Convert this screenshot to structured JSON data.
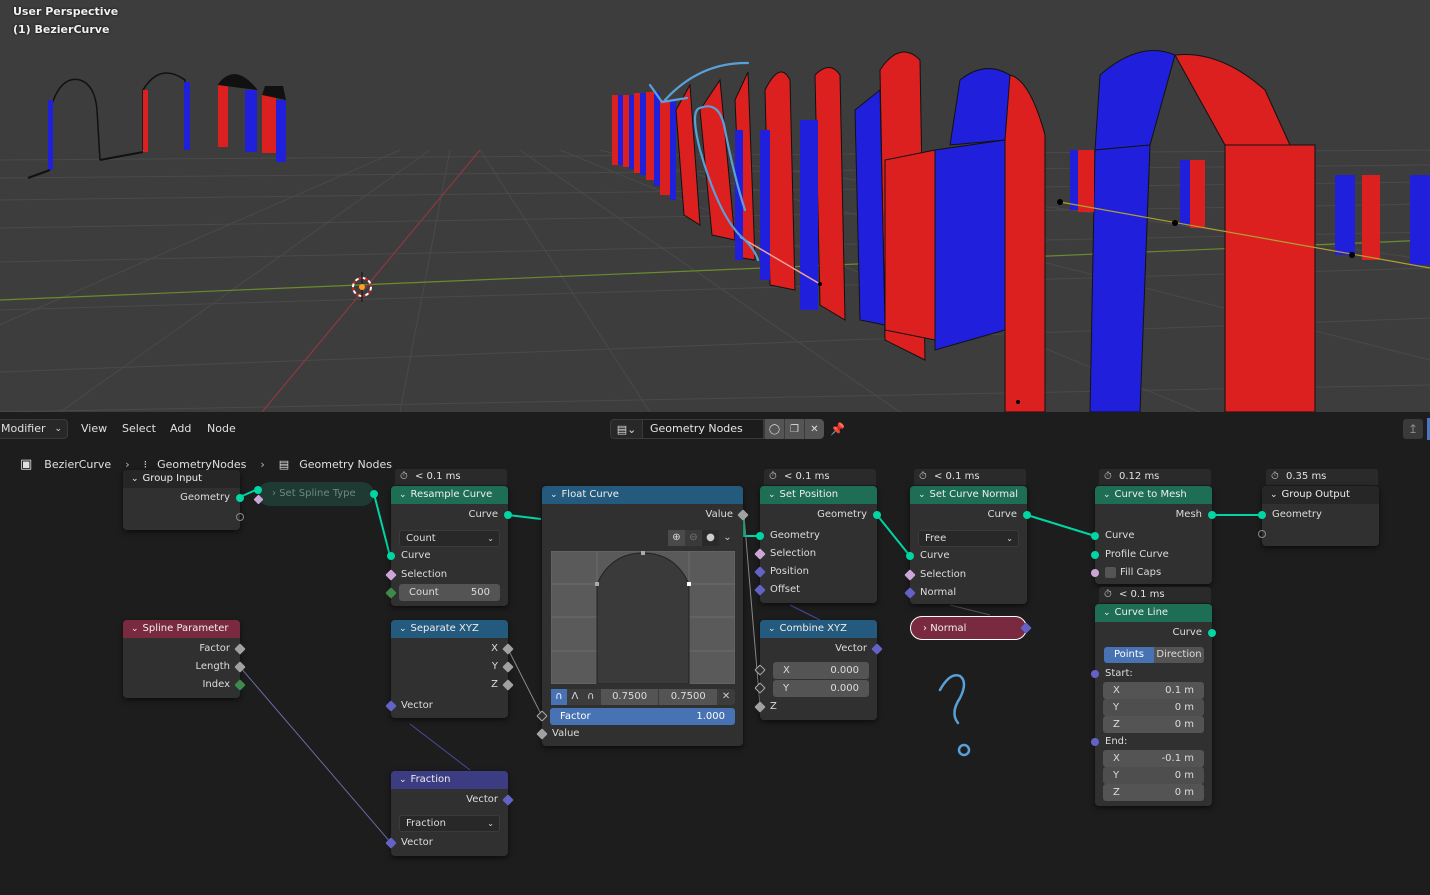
{
  "viewport": {
    "perspective_label": "User Perspective",
    "object_label": "(1) BezierCurve"
  },
  "header": {
    "editor_type": "Modifier",
    "menus": [
      "View",
      "Select",
      "Add",
      "Node"
    ],
    "node_group_name": "Geometry Nodes",
    "icons": [
      "node-tree-icon",
      "fake-user-shield-icon",
      "duplicate-icon",
      "close-icon",
      "pin-icon"
    ]
  },
  "breadcrumb": {
    "items": [
      "BezierCurve",
      "GeometryNodes",
      "Geometry Nodes"
    ]
  },
  "nodes": {
    "group_input": {
      "title": "Group Input",
      "outputs": [
        "Geometry"
      ]
    },
    "set_spline_type": {
      "title": "Set Spline Type",
      "collapsed": true
    },
    "resample_curve": {
      "timer": "< 0.1 ms",
      "title": "Resample Curve",
      "output": "Curve",
      "mode": "Count",
      "inputs": [
        "Curve",
        "Selection"
      ],
      "count_label": "Count",
      "count_value": "500"
    },
    "float_curve": {
      "title": "Float Curve",
      "output": "Value",
      "point_x": "0.7500",
      "point_y": "0.7500",
      "factor_label": "Factor",
      "factor_value": "1.000",
      "input": "Value"
    },
    "set_position": {
      "timer": "< 0.1 ms",
      "title": "Set Position",
      "output": "Geometry",
      "inputs": [
        "Geometry",
        "Selection",
        "Position",
        "Offset"
      ]
    },
    "combine_xyz": {
      "title": "Combine XYZ",
      "output": "Vector",
      "x_label": "X",
      "x_value": "0.000",
      "y_label": "Y",
      "y_value": "0.000",
      "z_label": "Z"
    },
    "set_curve_normal": {
      "timer": "< 0.1 ms",
      "title": "Set Curve Normal",
      "output": "Curve",
      "mode": "Free",
      "inputs": [
        "Curve",
        "Selection",
        "Normal"
      ]
    },
    "normal": {
      "title": "Normal",
      "collapsed": true
    },
    "curve_to_mesh": {
      "timer": "0.12 ms",
      "title": "Curve to Mesh",
      "output": "Mesh",
      "inputs": [
        "Curve",
        "Profile Curve"
      ],
      "fill_caps_label": "Fill Caps",
      "fill_caps": false
    },
    "curve_line": {
      "timer": "< 0.1 ms",
      "title": "Curve Line",
      "output": "Curve",
      "mode_tabs": [
        "Points",
        "Direction"
      ],
      "active_mode": "Points",
      "start_label": "Start:",
      "start": [
        {
          "axis": "X",
          "value": "0.1 m"
        },
        {
          "axis": "Y",
          "value": "0 m"
        },
        {
          "axis": "Z",
          "value": "0 m"
        }
      ],
      "end_label": "End:",
      "end": [
        {
          "axis": "X",
          "value": "-0.1 m"
        },
        {
          "axis": "Y",
          "value": "0 m"
        },
        {
          "axis": "Z",
          "value": "0 m"
        }
      ]
    },
    "group_output": {
      "timer": "0.35 ms",
      "title": "Group Output",
      "inputs": [
        "Geometry"
      ]
    },
    "spline_parameter": {
      "title": "Spline Parameter",
      "outputs": [
        "Factor",
        "Length",
        "Index"
      ]
    },
    "separate_xyz": {
      "title": "Separate XYZ",
      "outputs": [
        "X",
        "Y",
        "Z"
      ],
      "input": "Vector"
    },
    "fraction": {
      "title": "Fraction",
      "output": "Vector",
      "mode": "Fraction",
      "input": "Vector"
    }
  },
  "colors": {
    "geometry_socket": "#00d6a3",
    "vector_socket": "#6363c7",
    "float_socket": "#a1a1a1",
    "geometry_header": "#1e6e55",
    "converter_header": "#245a7d",
    "input_header": "#7a2a40",
    "vector_header": "#3c3c83",
    "arch_red": "#dc2020",
    "arch_blue": "#2020dc",
    "annotation": "#5aa0d8"
  }
}
